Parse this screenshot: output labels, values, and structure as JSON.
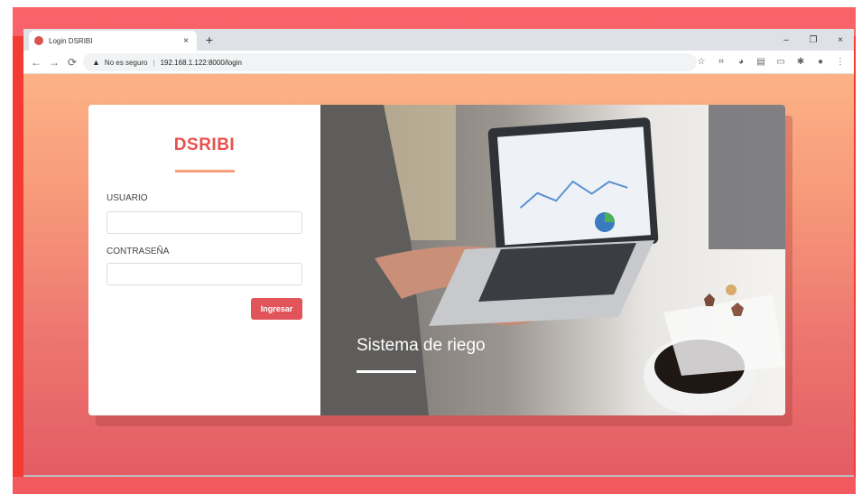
{
  "browser": {
    "tab_title": "Login DSRIBI",
    "tab_close": "×",
    "new_tab": "+",
    "omnibox": {
      "security_icon": "warning-triangle-icon",
      "security_text": "No es seguro",
      "separator": "|",
      "url": "192.168.1.122:8000/login"
    },
    "window_controls": [
      "–",
      "❐",
      "×"
    ],
    "toolbar_icons": [
      "star-icon",
      "screenshot-icon",
      "extension-icon",
      "reader-icon",
      "media-icon",
      "puzzle-icon",
      "profile-icon",
      "menu-icon"
    ]
  },
  "login": {
    "brand": "DSRIBI",
    "username_label": "USUARIO",
    "username_value": "",
    "password_label": "CONTRASEÑA",
    "password_value": "",
    "submit_label": "Ingresar"
  },
  "hero": {
    "title": "Sistema de riego"
  },
  "colors": {
    "brand": "#e8514b",
    "accent": "#f6a07a",
    "button": "#e0545a",
    "frame": "#f8636a"
  }
}
